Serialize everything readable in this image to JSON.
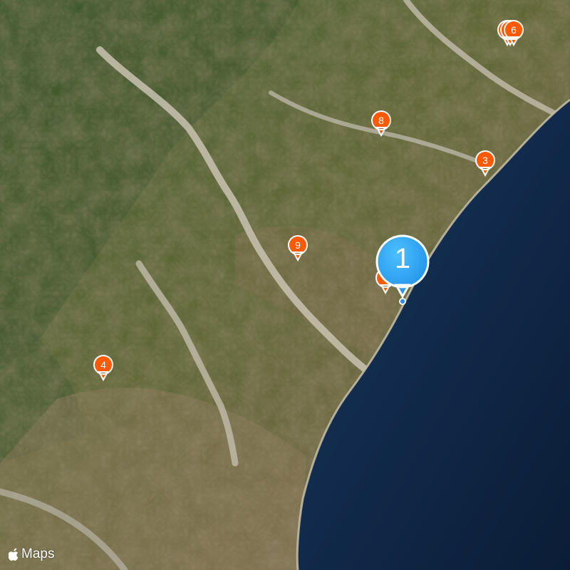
{
  "map": {
    "type": "satellite",
    "colors": {
      "sea": "#0f2a47",
      "land": "#4a5c32",
      "riverbed": "#cfc8b8",
      "pin_orange": "#ff5a00",
      "pin_blue": "#2aa0f0"
    }
  },
  "pins": [
    {
      "label": "1",
      "kind": "cluster",
      "color": "#2aa0f0"
    },
    {
      "label": "",
      "kind": "marker",
      "color": "#ff5a00"
    },
    {
      "label": "3",
      "kind": "marker",
      "color": "#ff5a00"
    },
    {
      "label": "4",
      "kind": "marker",
      "color": "#ff5a00"
    },
    {
      "label": "",
      "kind": "marker",
      "color": "#ff5a00"
    },
    {
      "label": "",
      "kind": "marker",
      "color": "#ff5a00"
    },
    {
      "label": "6",
      "kind": "marker",
      "color": "#ff5a00"
    },
    {
      "label": "8",
      "kind": "marker",
      "color": "#ff5a00"
    },
    {
      "label": "9",
      "kind": "marker",
      "color": "#ff5a00"
    }
  ],
  "location_dot": {
    "color": "#2a8ef5",
    "icon": "user-location-icon"
  },
  "logo": {
    "text": "Maps",
    "icon": "apple-logo-icon"
  }
}
